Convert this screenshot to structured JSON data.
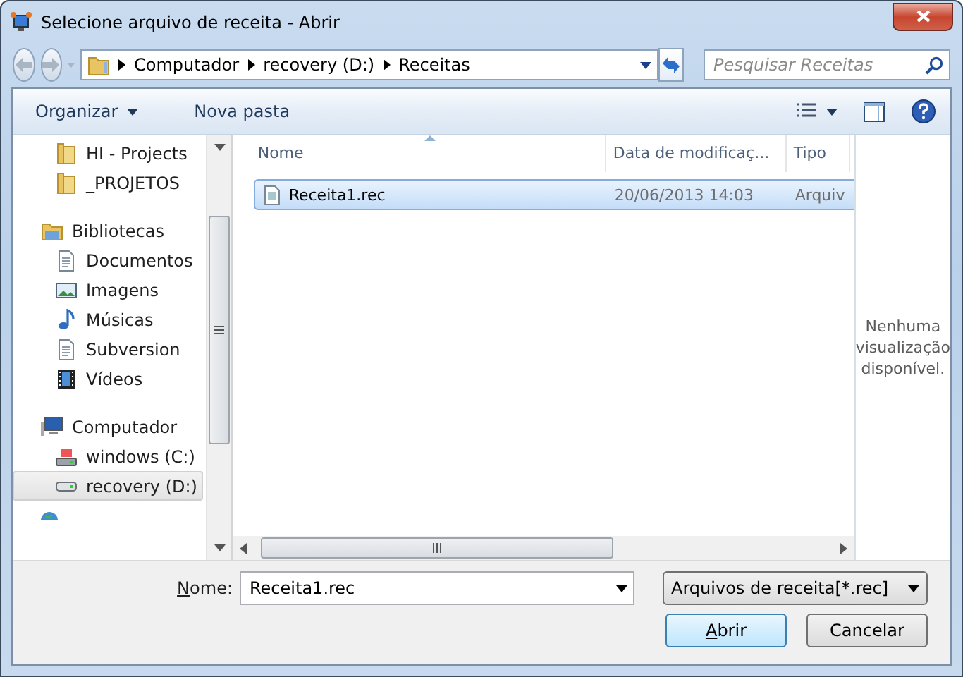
{
  "window": {
    "title": "Selecione arquivo de receita - Abrir"
  },
  "address": {
    "crumbs": [
      "Computador",
      "recovery (D:)",
      "Receitas"
    ]
  },
  "search": {
    "placeholder": "Pesquisar Receitas"
  },
  "toolbar": {
    "organize": "Organizar",
    "new_folder": "Nova pasta"
  },
  "nav": {
    "top_children": [
      {
        "label": "HI - Projects",
        "kind": "folder",
        "selected": false
      },
      {
        "label": "_PROJETOS",
        "kind": "folder",
        "selected": false
      }
    ],
    "groups": [
      {
        "label": "Bibliotecas",
        "kind": "library",
        "children": [
          {
            "label": "Documentos",
            "kind": "documents",
            "selected": false
          },
          {
            "label": "Imagens",
            "kind": "pictures",
            "selected": false
          },
          {
            "label": "Músicas",
            "kind": "music",
            "selected": false
          },
          {
            "label": "Subversion",
            "kind": "documents",
            "selected": false
          },
          {
            "label": "Vídeos",
            "kind": "videos",
            "selected": false
          }
        ]
      },
      {
        "label": "Computador",
        "kind": "computer",
        "children": [
          {
            "label": "windows (C:)",
            "kind": "system-drive",
            "selected": false
          },
          {
            "label": "recovery (D:)",
            "kind": "drive",
            "selected": true
          }
        ]
      }
    ]
  },
  "table": {
    "columns": [
      "Nome",
      "Data de modificaç...",
      "Tipo"
    ],
    "rows": [
      {
        "name": "Receita1.rec",
        "modified": "20/06/2013 14:03",
        "type": "Arquiv",
        "selected": true
      }
    ]
  },
  "preview": {
    "message": "Nenhuma visualização disponível."
  },
  "file_name": {
    "label": "Nome:",
    "value": "Receita1.rec"
  },
  "file_type": {
    "value": "Arquivos de receita[*.rec]"
  },
  "buttons": [
    {
      "label": "Abrir",
      "kind": "default"
    },
    {
      "label": "Cancelar",
      "kind": "normal"
    }
  ]
}
